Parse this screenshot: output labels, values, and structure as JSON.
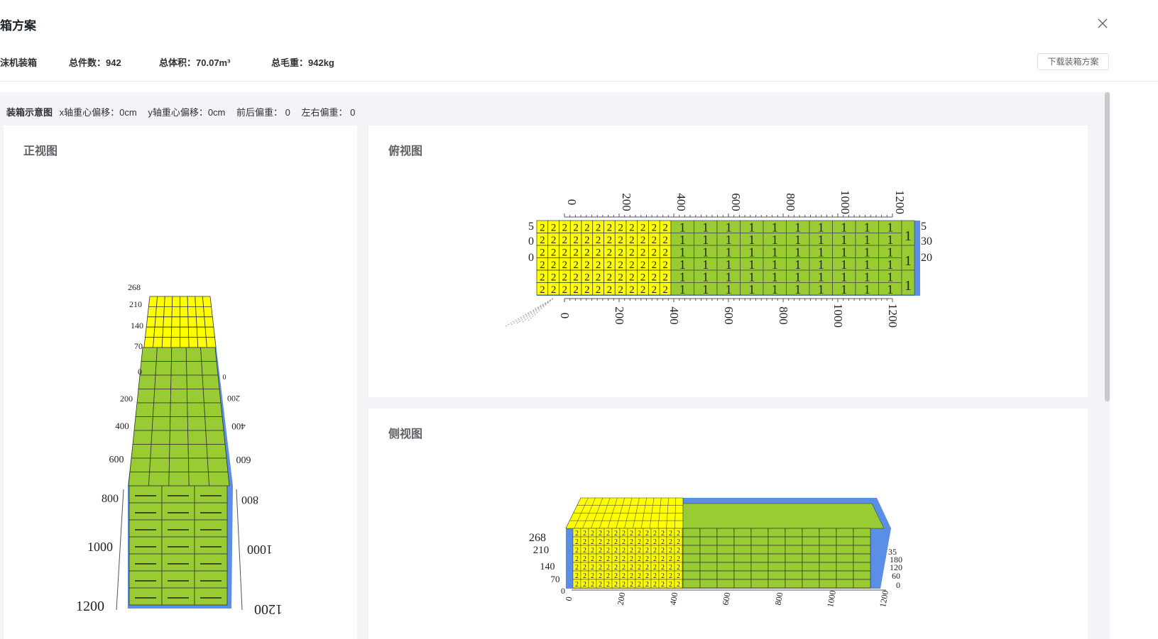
{
  "header": {
    "title": "箱方案",
    "close_icon": "close-icon"
  },
  "summary": {
    "mode": "沫机装箱",
    "count_label": "总件数：",
    "count": "942",
    "volume_label": "总体积：",
    "volume": "70.07m³",
    "weight_label": "总毛重：",
    "weight": "942kg",
    "download_label": "下载装箱方案"
  },
  "diagram": {
    "title": "装箱示意图",
    "x_offset": "x轴重心偏移：0cm",
    "y_offset": "y轴重心偏移：0cm",
    "fb_offset": "前后偏重：  0",
    "lr_offset": "左右偏重：  0"
  },
  "colors": {
    "item1": "#99cc33",
    "item2": "#ffff00",
    "container": "#5b8ee6"
  },
  "views": {
    "front": {
      "title": "正视图",
      "height_ticks": [
        "268",
        "210",
        "140",
        "70",
        "0"
      ],
      "length_ticks": [
        "200",
        "400",
        "600",
        "800",
        "1000",
        "1200"
      ]
    },
    "top": {
      "title": "俯视图",
      "length_ticks": [
        "0",
        "200",
        "400",
        "600",
        "800",
        "1000",
        "1200"
      ],
      "left_ticks": [
        "5",
        "0",
        "0"
      ],
      "right_ticks": [
        "5",
        "30",
        "20"
      ],
      "labels": [
        "2",
        "1"
      ],
      "cols_item2": 12,
      "cols_item1": 10,
      "rows": 6
    },
    "side": {
      "title": "侧视图",
      "left_ticks": [
        "268",
        "210",
        "140",
        "70",
        "0"
      ],
      "right_ticks": [
        "35",
        "180",
        "120",
        "60",
        "0"
      ],
      "length_ticks": [
        "0",
        "200",
        "400",
        "600",
        "800",
        "1000",
        "1200"
      ]
    }
  }
}
